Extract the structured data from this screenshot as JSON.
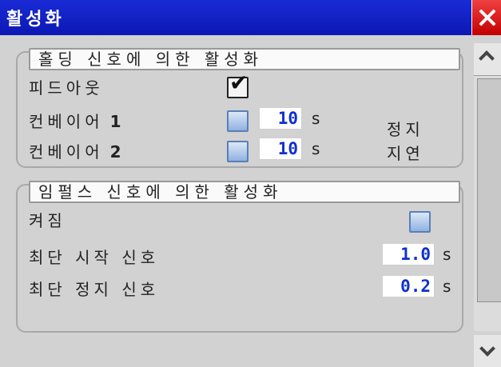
{
  "window": {
    "title": "활성화",
    "title_color": "#1a2bd6",
    "close_icon": "close-icon",
    "close_color": "#e02020"
  },
  "holding_section": {
    "header": "홀딩 신호에 의한 활성화",
    "feed_out": {
      "label": "피드아웃",
      "checked": true
    },
    "conveyor1": {
      "label": "컨베이어",
      "num": "1",
      "value": "10",
      "unit": "s",
      "checked": false
    },
    "conveyor2": {
      "label": "컨베이어",
      "num": "2",
      "value": "10",
      "unit": "s",
      "checked": false
    },
    "stop_label": "정지",
    "delay_label": "지연"
  },
  "impulse_section": {
    "header": "임펄스 신호에 의한 활성화",
    "on": {
      "label": "켜짐",
      "checked": false
    },
    "min_start": {
      "label": "최단 시작 신호",
      "value": "1.0",
      "unit": "s"
    },
    "min_stop": {
      "label": "최단 정지 신호",
      "value": "0.2",
      "unit": "s"
    }
  },
  "scrollbar": {
    "up_icon": "chevron-up-icon",
    "down_icon": "chevron-down-icon",
    "position": 0
  },
  "accent_value_color": "#1030d0"
}
